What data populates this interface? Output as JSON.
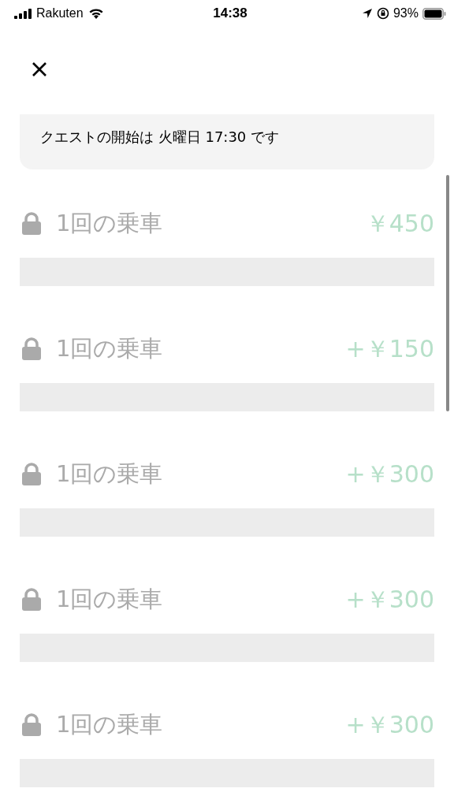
{
  "status_bar": {
    "carrier": "Rakuten",
    "time": "14:38",
    "battery": "93%"
  },
  "notice": {
    "text": "クエストの開始は 火曜日 17:30 です"
  },
  "steps": [
    {
      "title": "1回の乗車",
      "reward": "￥450",
      "locked": true,
      "level": 0
    },
    {
      "title": "1回の乗車",
      "reward": "+￥150",
      "locked": true,
      "level": 0
    },
    {
      "title": "1回の乗車",
      "reward": "+￥300",
      "locked": true,
      "level": 0
    },
    {
      "title": "1回の乗車",
      "reward": "+￥300",
      "locked": true,
      "level": 0
    },
    {
      "title": "1回の乗車",
      "reward": "+￥300",
      "locked": true,
      "level": 0
    }
  ]
}
